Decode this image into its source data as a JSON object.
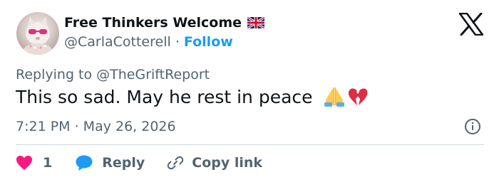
{
  "author": {
    "display_name": "Free Thinkers Welcome",
    "flag_icon": "uk-flag-icon",
    "handle": "@CarlaCotterell",
    "separator": "·",
    "follow_label": "Follow"
  },
  "reply_context": {
    "text": "Replying to @TheGriftReport"
  },
  "tweet": {
    "text": "This so sad. May he rest in peace",
    "emojis": [
      "folded-hands-emoji",
      "broken-heart-emoji"
    ],
    "timestamp": "7:21 PM · May 26, 2026"
  },
  "actions": {
    "like_count": "1",
    "reply_label": "Reply",
    "copy_link_label": "Copy link"
  },
  "colors": {
    "accent": "#1d9bf0",
    "like": "#f91880",
    "secondary_text": "#536471",
    "primary_text": "#0f1419",
    "divider": "#cfd9de"
  }
}
